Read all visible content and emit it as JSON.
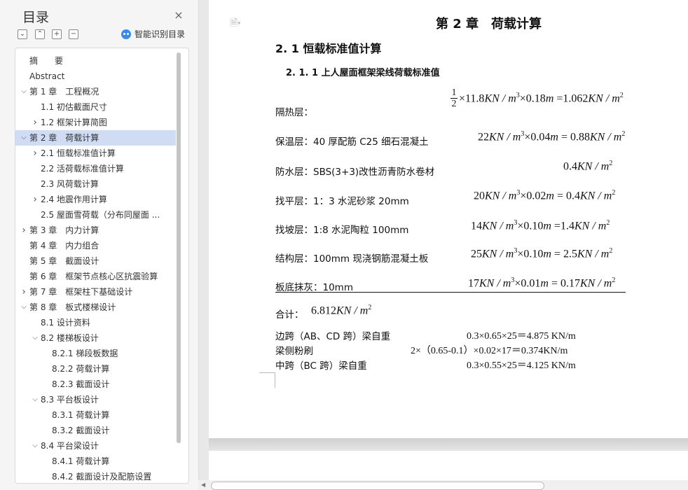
{
  "sidebar": {
    "title": "目录",
    "close_label": "×",
    "tools": {
      "collapse_all": "−",
      "expand_all": "+",
      "add": "+",
      "remove": "−"
    },
    "smart_toc_label": "智能识别目录",
    "items": [
      {
        "label": "摘　　要",
        "level": 0,
        "expander": "",
        "active": false
      },
      {
        "label": "Abstract",
        "level": 0,
        "expander": "",
        "active": false
      },
      {
        "label": "第 1 章　工程概况",
        "level": 0,
        "expander": "expanded",
        "active": false
      },
      {
        "label": "1.1  初估截面尺寸",
        "level": 1,
        "expander": "",
        "active": false
      },
      {
        "label": "1.2  框架计算简图",
        "level": 1,
        "expander": "collapsed",
        "active": false
      },
      {
        "label": "第 2 章　荷载计算",
        "level": 0,
        "expander": "expanded",
        "active": true
      },
      {
        "label": "2.1  恒载标准值计算",
        "level": 1,
        "expander": "collapsed",
        "active": false
      },
      {
        "label": "2.2  活荷载标准值计算",
        "level": 1,
        "expander": "",
        "active": false
      },
      {
        "label": "2.3  风荷载计算",
        "level": 1,
        "expander": "",
        "active": false
      },
      {
        "label": "2.4 地震作用计算",
        "level": 1,
        "expander": "collapsed",
        "active": false
      },
      {
        "label": "2.5  屋面雪荷载（分布同屋面 ...",
        "level": 1,
        "expander": "",
        "active": false
      },
      {
        "label": "第 3 章　内力计算",
        "level": 0,
        "expander": "collapsed",
        "active": false
      },
      {
        "label": "第 4 章　内力组合",
        "level": 0,
        "expander": "",
        "active": false
      },
      {
        "label": "第 5 章　截面设计",
        "level": 0,
        "expander": "",
        "active": false
      },
      {
        "label": "第 6 章　框架节点核心区抗震验算",
        "level": 0,
        "expander": "",
        "active": false
      },
      {
        "label": "第 7 章　框架柱下基础设计",
        "level": 0,
        "expander": "collapsed",
        "active": false
      },
      {
        "label": "第 8 章　板式楼梯设计",
        "level": 0,
        "expander": "expanded",
        "active": false
      },
      {
        "label": "8.1 设计资料",
        "level": 1,
        "expander": "",
        "active": false
      },
      {
        "label": "8.2 楼梯板设计",
        "level": 1,
        "expander": "expanded",
        "active": false
      },
      {
        "label": "8.2.1 梯段板数据",
        "level": 2,
        "expander": "",
        "active": false
      },
      {
        "label": "8.2.2 荷载计算",
        "level": 2,
        "expander": "",
        "active": false
      },
      {
        "label": "8.2.3 截面设计",
        "level": 2,
        "expander": "",
        "active": false
      },
      {
        "label": "8.3 平台板设计",
        "level": 1,
        "expander": "expanded",
        "active": false
      },
      {
        "label": "8.3.1 荷载计算",
        "level": 2,
        "expander": "",
        "active": false
      },
      {
        "label": "8.3.2 截面设计",
        "level": 2,
        "expander": "",
        "active": false
      },
      {
        "label": "8.4 平台梁设计",
        "level": 1,
        "expander": "expanded",
        "active": false
      },
      {
        "label": "8.4.1 荷载计算",
        "level": 2,
        "expander": "",
        "active": false
      },
      {
        "label": "8.4.2 截面设计及配筋设置",
        "level": 2,
        "expander": "",
        "active": false
      }
    ]
  },
  "document": {
    "chapter_title": "第 2 章　荷载计算",
    "section_title": "2. 1  恒载标准值计算",
    "subsection_title": "2. 1. 1  上人屋面框架梁线荷载标准值",
    "layers": {
      "insulation": {
        "label": "隔热层：",
        "frac_num": "1",
        "frac_den": "2",
        "formula_pre": "×11.8",
        "formula_unit1": "KN / m",
        "sup1": "3",
        "formula_mid": "×0.18",
        "formula_m": "m",
        "formula_eq": " =1.062",
        "formula_unit2": "KN / m",
        "sup2": "2"
      },
      "thermal": {
        "label": "保温层：40 厚配筋 C25 细石混凝土",
        "f_a": "22",
        "u1": "KN / m",
        "s1": "3",
        "f_b": "×0.04",
        "m": "m",
        "f_c": " = 0.88",
        "u2": "KN / m",
        "s2": "2"
      },
      "waterproof": {
        "label": "防水层：SBS(3+3)改性沥青防水卷材",
        "f_a": "0.4",
        "u1": "KN / m",
        "s1": "2"
      },
      "leveling": {
        "label": "找平层：1：3 水泥砂浆 20mm",
        "f_a": "20",
        "u1": "KN / m",
        "s1": "3",
        "f_b": "×0.02",
        "m": "m",
        "f_c": " = 0.4",
        "u2": "KN / m",
        "s2": "2"
      },
      "slope": {
        "label": "找坡层：1:8 水泥陶粒 100mm",
        "f_a": "14",
        "u1": "KN / m",
        "s1": "3",
        "f_b": "×0.10",
        "m": "m",
        "f_c": " =1.4",
        "u2": "KN / m",
        "s2": "2"
      },
      "structural": {
        "label": "结构层：100mm 现浇钢筋混凝土板",
        "f_a": "25",
        "u1": "KN / m",
        "s1": "3",
        "f_b": "×0.10",
        "m": "m",
        "f_c": " = 2.5",
        "u2": "KN / m",
        "s2": "2"
      },
      "plaster": {
        "label": "板底抹灰：10mm",
        "f_a": "17",
        "u1": "KN / m",
        "s1": "3",
        "f_b": "×0.01",
        "m": "m",
        "f_c": " = 0.17",
        "u2": "KN / m",
        "s2": "2"
      }
    },
    "total": {
      "label": "合计：",
      "value": "6.812",
      "unit": "KN / m",
      "sup": "2"
    },
    "beams": [
      {
        "label": "边跨（AB、CD 跨）梁自重",
        "formula": "0.3×0.65×25＝4.875 KN/m"
      },
      {
        "label": "梁侧粉刷",
        "formula": "2×（0.65-0.1）×0.02×17＝0.374KN/m"
      },
      {
        "label": "中跨（BC 跨）梁自重",
        "formula": "0.3×0.55×25＝4.125 KN/m"
      }
    ],
    "doc_icon_arrow": "▾"
  },
  "scrollbar": {
    "left_arrow": "◀"
  }
}
